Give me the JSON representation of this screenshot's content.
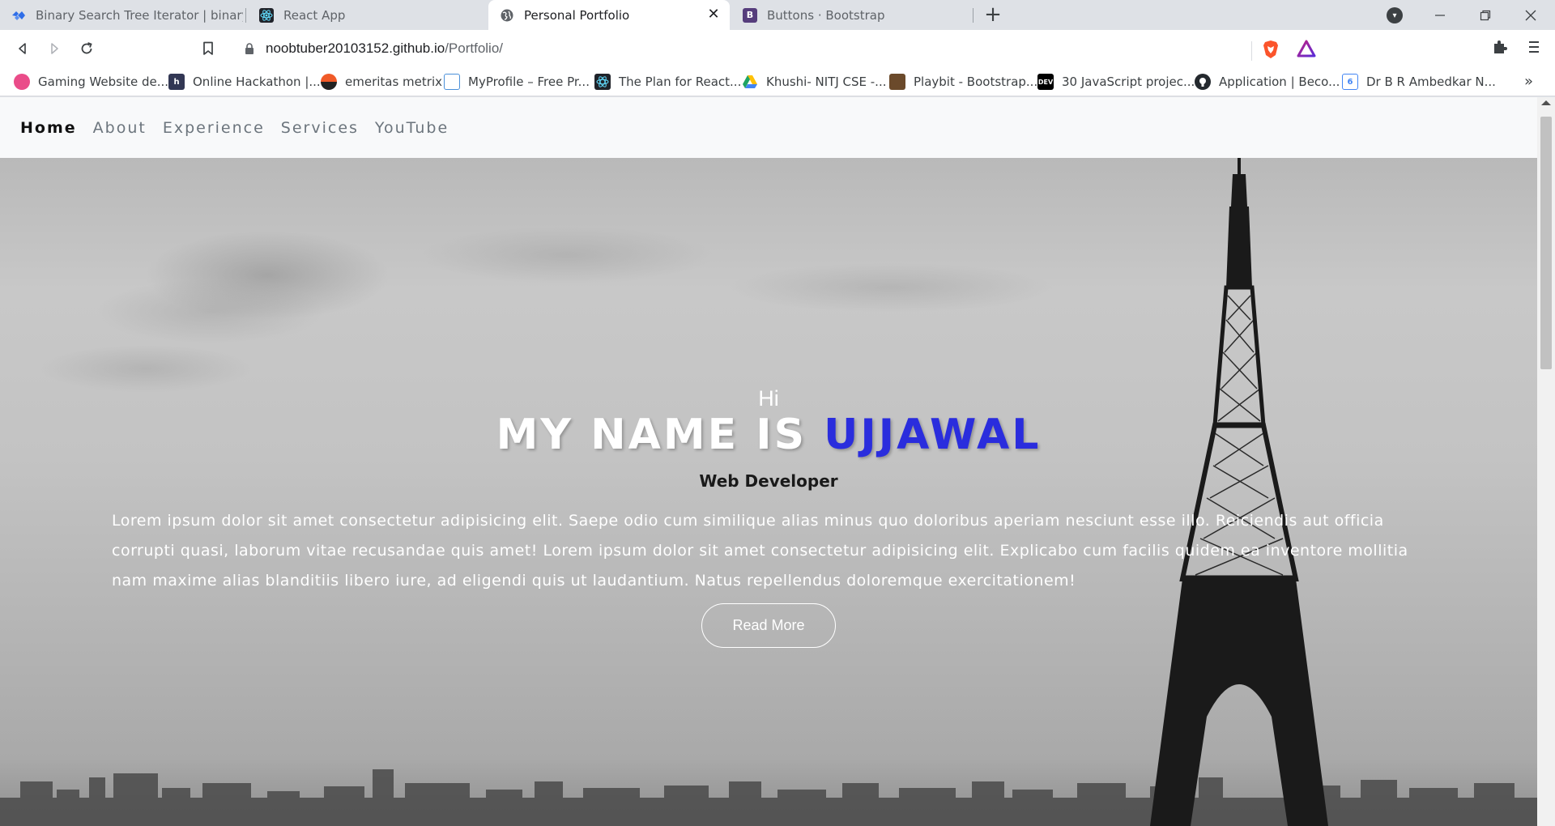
{
  "browser": {
    "tabs": [
      {
        "title": "Binary Search Tree Iterator | binarysea",
        "icon": "binarysearch-logo-icon",
        "active": false
      },
      {
        "title": "React App",
        "icon": "react-logo-icon",
        "active": false
      },
      {
        "title": "Personal Portfolio",
        "icon": "globe-icon",
        "active": true
      },
      {
        "title": "Buttons · Bootstrap",
        "icon": "bootstrap-logo-icon",
        "active": false
      }
    ],
    "new_tab_glyph": "+",
    "url_host": "noobtuber20103152.github.io",
    "url_path": "/Portfolio/",
    "bookmarks": [
      {
        "label": "Gaming Website de...",
        "icon": "dribbble-icon",
        "color": "#ea4c89"
      },
      {
        "label": "Online Hackathon |...",
        "icon": "hackerearth-icon",
        "color": "#323754"
      },
      {
        "label": "emeritas metrix",
        "icon": "emeritas-icon",
        "color": "#f05a28"
      },
      {
        "label": "MyProfile – Free Pr...",
        "icon": "page-icon",
        "color": "#4a90d9"
      },
      {
        "label": "The Plan for React...",
        "icon": "react-logo-icon",
        "color": "#20232a"
      },
      {
        "label": "Khushi- NITJ CSE -...",
        "icon": "google-drive-icon",
        "color": "#1fa463"
      },
      {
        "label": "Playbit - Bootstrap...",
        "icon": "playbit-icon",
        "color": "#6b4a2b"
      },
      {
        "label": "30 JavaScript projec...",
        "icon": "dev-logo-icon",
        "color": "#000000"
      },
      {
        "label": "Application | Beco...",
        "icon": "github-icon",
        "color": "#24292e"
      },
      {
        "label": "Dr B R Ambedkar N...",
        "icon": "google-classroom-icon",
        "color": "#4285f4"
      }
    ],
    "bookmarks_more": "»"
  },
  "site": {
    "nav": [
      "Home",
      "About",
      "Experience",
      "Services",
      "YouTube"
    ],
    "active_nav": "Home",
    "greeting": "Hi",
    "headline_prefix": "MY NAME IS ",
    "headline_name": "UJJAWAL",
    "role": "Web Developer",
    "intro": "Lorem ipsum dolor sit amet consectetur adipisicing elit. Saepe odio cum similique alias minus quo doloribus aperiam nesciunt esse illo. Reiciendis aut officia corrupti quasi, laborum vitae recusandae quis amet! Lorem ipsum dolor sit amet consectetur adipisicing elit. Explicabo cum facilis quidem ea inventore mollitia nam maxime alias blanditiis libero iure, ad eligendi quis ut laudantium. Natus repellendus doloremque exercitationem!",
    "cta": "Read More"
  },
  "colors": {
    "accent": "#2a2ddd",
    "nav_bg": "#f8f9fa"
  }
}
